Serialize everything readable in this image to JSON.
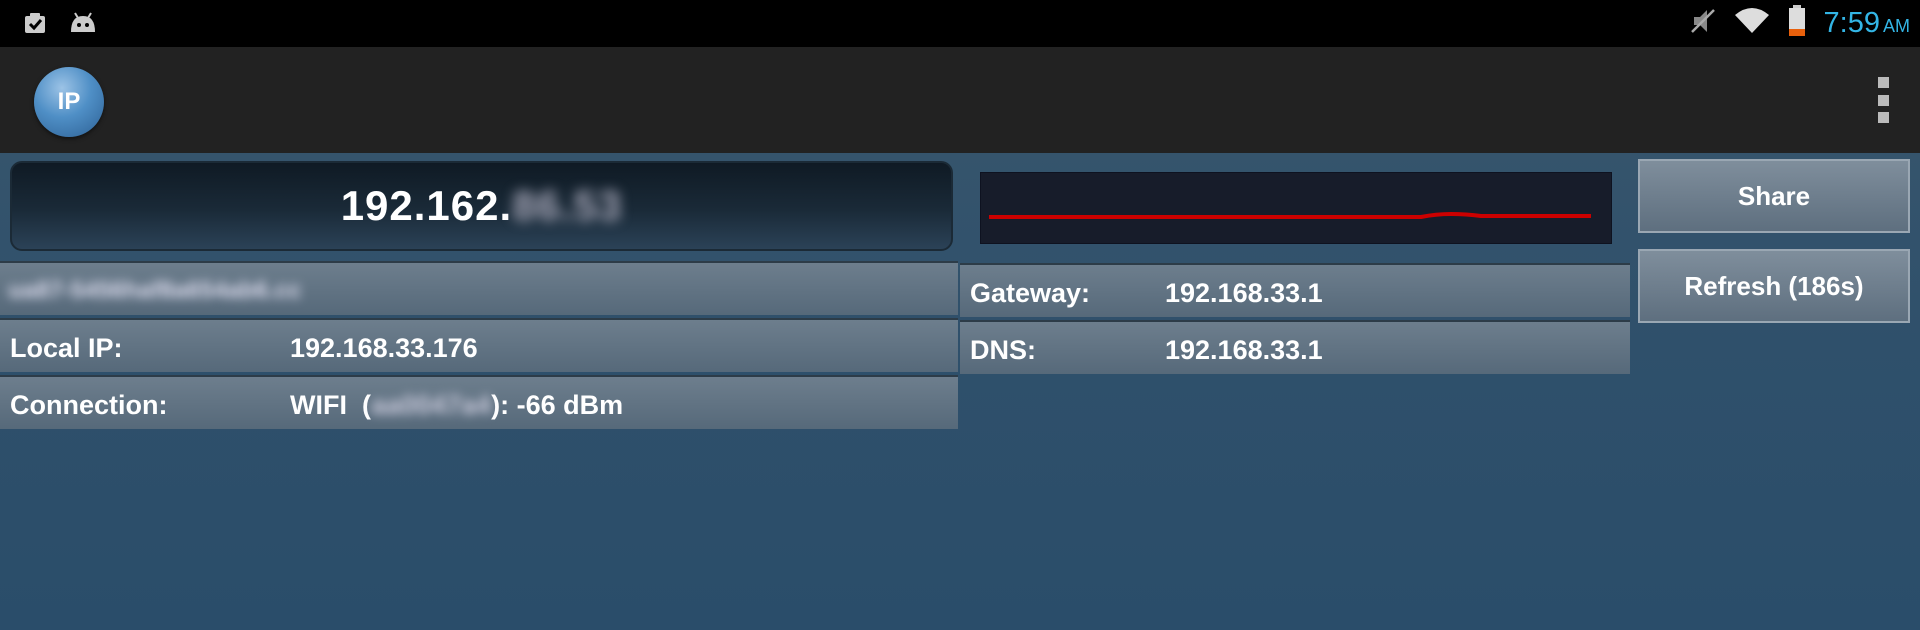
{
  "status_bar": {
    "time": "7:59",
    "ampm": "AM",
    "icons": [
      "clipboard-check-icon",
      "android-icon",
      "mute-icon",
      "wifi-icon",
      "battery-icon"
    ]
  },
  "action_bar": {
    "logo_text": "IP",
    "menu_icon": "overflow-menu-icon"
  },
  "ip": {
    "visible": "192.162.",
    "hidden": "86.53"
  },
  "hostname": {
    "hidden_value": "ua87-5456haf8a654ab6.cc"
  },
  "local_ip": {
    "label": "Local IP:",
    "value": "192.168.33.176"
  },
  "connection": {
    "label": "Connection:",
    "prefix": "WIFI  (",
    "hidden_ssid": "aa0047a4",
    "suffix": "): -66 dBm"
  },
  "gateway": {
    "label": "Gateway:",
    "value": "192.168.33.1"
  },
  "dns": {
    "label": "DNS:",
    "value": "192.168.33.1"
  },
  "buttons": {
    "share": "Share",
    "refresh": "Refresh (186s)"
  },
  "colors": {
    "accent": "#33b5e5",
    "graph_line": "#cc0000"
  }
}
